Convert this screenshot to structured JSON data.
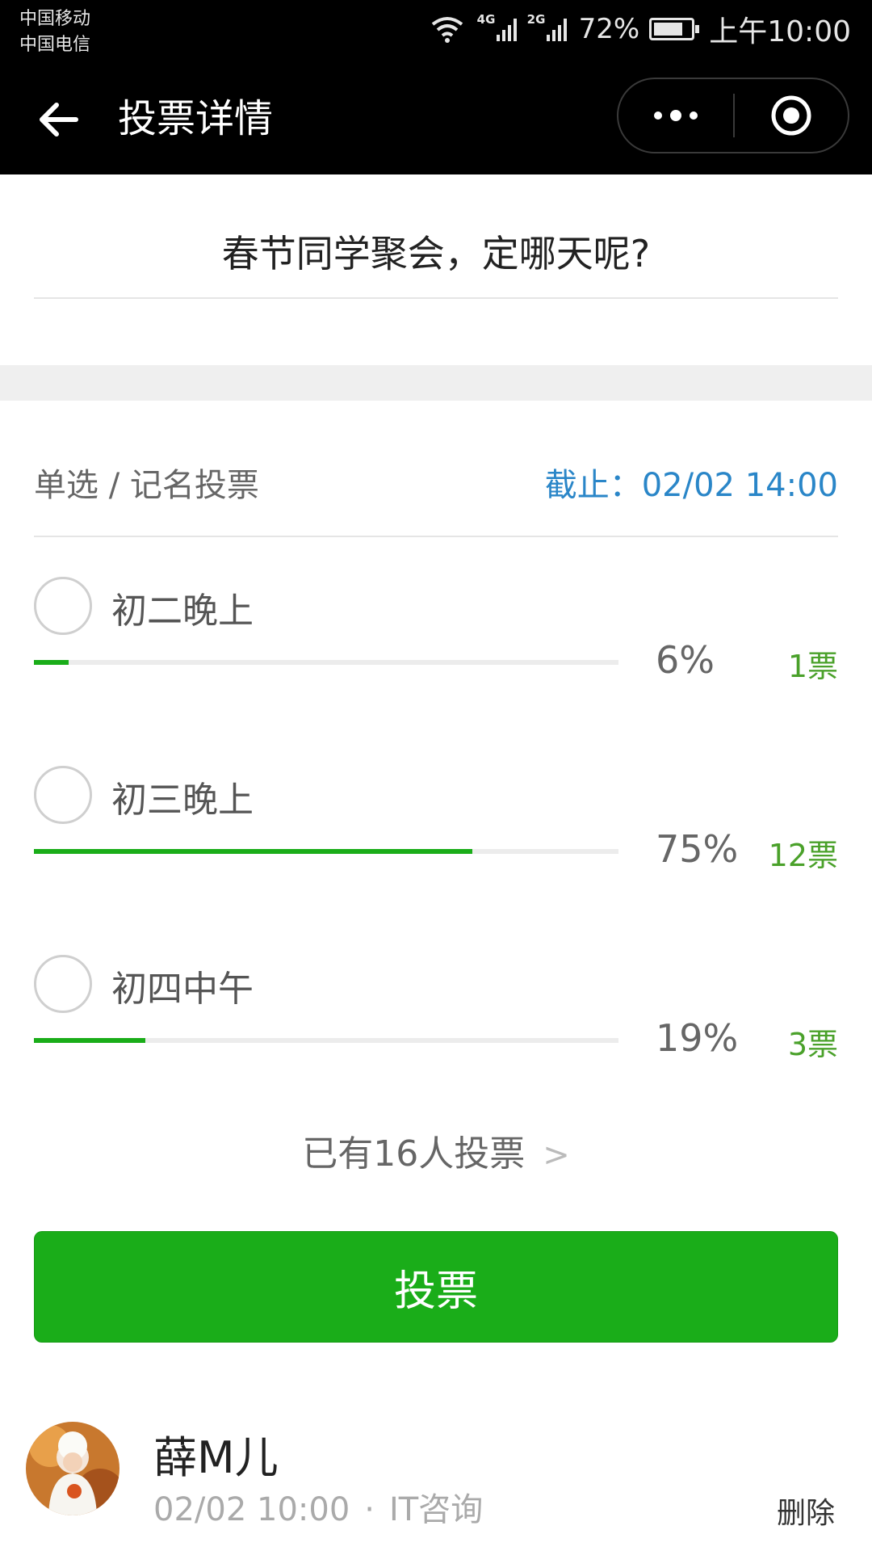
{
  "status_bar": {
    "carrier_1": "中国移动",
    "carrier_2": "中国电信",
    "signal_1_tag": "4G",
    "signal_2_tag": "2G",
    "battery": "72%",
    "time": "上午10:00"
  },
  "nav": {
    "title": "投票详情",
    "more_icon": "more-dots-icon",
    "target_icon": "target-icon"
  },
  "vote": {
    "title": "春节同学聚会，定哪天呢?",
    "type": "单选 / 记名投票",
    "deadline": "截止：02/02 14:00"
  },
  "options": [
    {
      "label": "初二晚上",
      "percent": "6%",
      "count": "1票",
      "progress": 0.06
    },
    {
      "label": "初三晚上",
      "percent": "75%",
      "count": "12票",
      "progress": 0.75
    },
    {
      "label": "初四中午",
      "percent": "19%",
      "count": "3票",
      "progress": 0.19
    }
  ],
  "voters_link": {
    "text": "已有16人投票",
    "chevron": ">"
  },
  "vote_button": {
    "label": "投票"
  },
  "comment": {
    "name": "薛M儿",
    "time": "02/02 10:00",
    "separator": "·",
    "org": "IT咨询",
    "delete_label": "删除"
  },
  "colors": {
    "accent_green": "#1aad19",
    "deadline_blue": "#2a86c8",
    "count_green": "#4aa12a"
  }
}
